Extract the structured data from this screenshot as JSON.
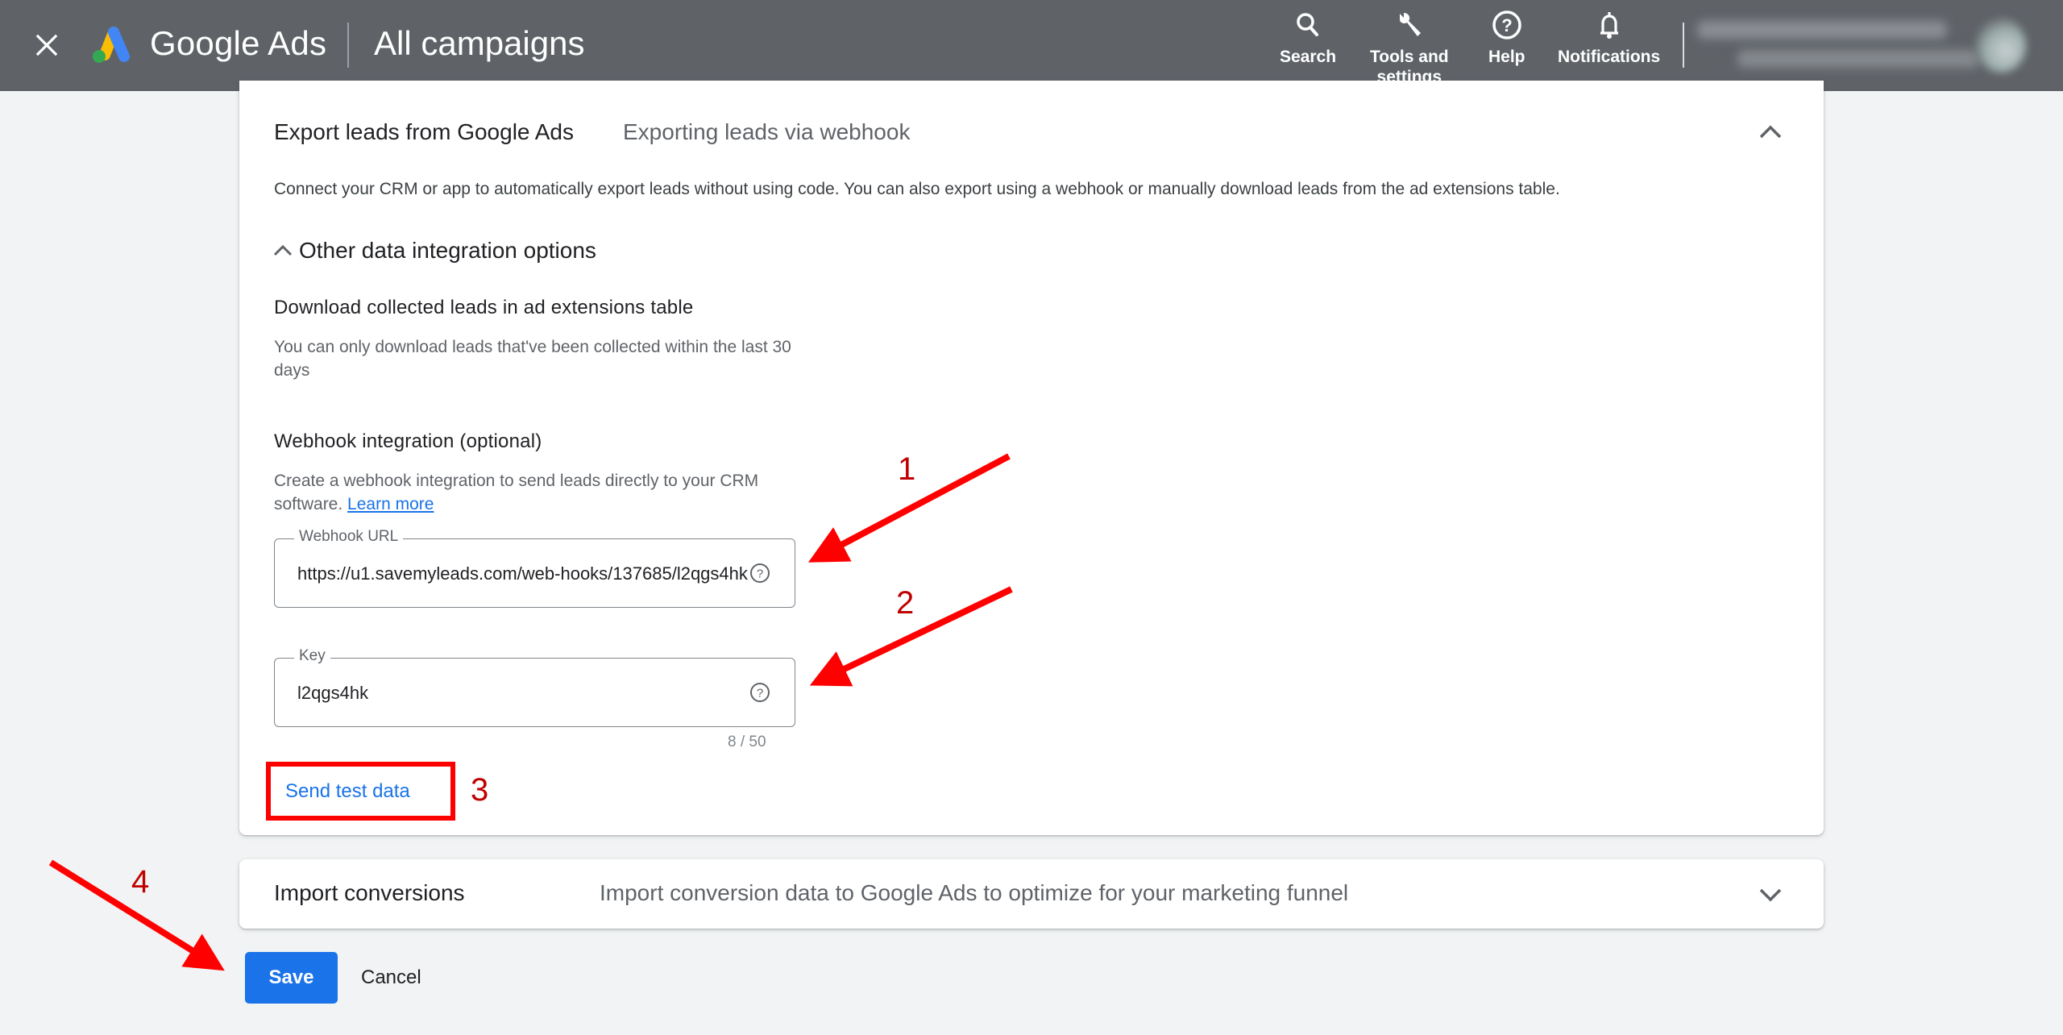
{
  "header": {
    "close_icon": "close-icon",
    "brand": "Google Ads",
    "page_title": "All campaigns",
    "nav": [
      {
        "label": "Search",
        "icon": "search-icon"
      },
      {
        "label": "Tools and\nsettings",
        "icon": "wrench-icon"
      },
      {
        "label": "Help",
        "icon": "help-circle-icon"
      },
      {
        "label": "Notifications",
        "icon": "bell-icon"
      }
    ],
    "account": {
      "blurred": true
    }
  },
  "export_section": {
    "title": "Export leads from Google Ads",
    "subtitle": "Exporting leads via webhook",
    "expanded": true,
    "description": "Connect your CRM or app to automatically export leads without using code. You can also export using a webhook or manually download leads from the ad extensions table.",
    "other_options": {
      "label": "Other data integration options",
      "expanded": true
    },
    "download": {
      "heading": "Download collected leads in ad extensions table",
      "text": "You can only download leads that've been collected within the last 30 days"
    },
    "webhook": {
      "heading": "Webhook integration (optional)",
      "text": "Create a webhook integration to send leads directly to your CRM software.",
      "learn_more": "Learn more",
      "url_field": {
        "label": "Webhook URL",
        "value": "https://u1.savemyleads.com/web-hooks/137685/l2qgs4hk"
      },
      "key_field": {
        "label": "Key",
        "value": "l2qgs4hk",
        "counter": "8 / 50"
      },
      "send_test_label": "Send test data"
    }
  },
  "import_section": {
    "title": "Import conversions",
    "subtitle": "Import conversion data to Google Ads to optimize for your marketing funnel",
    "expanded": false
  },
  "actions": {
    "save_label": "Save",
    "cancel_label": "Cancel"
  },
  "annotations": {
    "color": "#ff0000",
    "label_color": "#c00000",
    "labels": [
      "1",
      "2",
      "3",
      "4"
    ]
  },
  "colors": {
    "topbar": "#5f6368",
    "primary": "#1a73e8",
    "background": "#f1f3f4"
  }
}
